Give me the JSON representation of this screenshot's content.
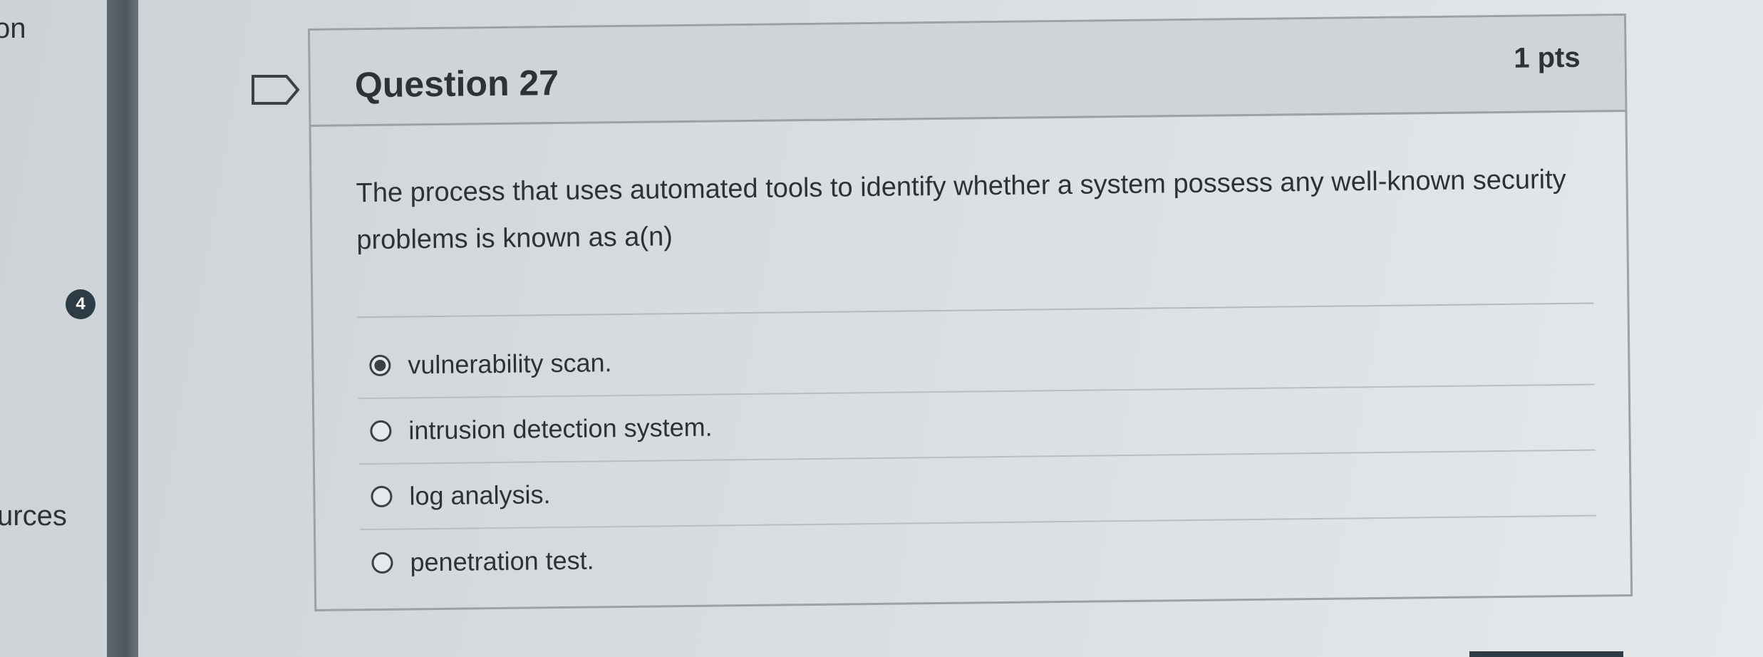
{
  "left_nav": {
    "top_text": "on",
    "badge_count": "4",
    "bottom_text": "urces"
  },
  "question": {
    "title": "Question 27",
    "points": "1 pts",
    "text": "The process that uses automated tools to identify whether a system possess any well-known security problems is known as a(n)",
    "answers": [
      {
        "label": "vulnerability scan.",
        "selected": true
      },
      {
        "label": "intrusion detection system.",
        "selected": false
      },
      {
        "label": "log analysis.",
        "selected": false
      },
      {
        "label": "penetration test.",
        "selected": false
      }
    ]
  },
  "colors": {
    "text": "#2c3338",
    "badge": "#2d3b45",
    "border": "#9aa2a8"
  },
  "icons": {
    "flag": "flag-icon",
    "radio_selected": "radio-checked-icon",
    "radio_empty": "radio-empty-icon"
  }
}
